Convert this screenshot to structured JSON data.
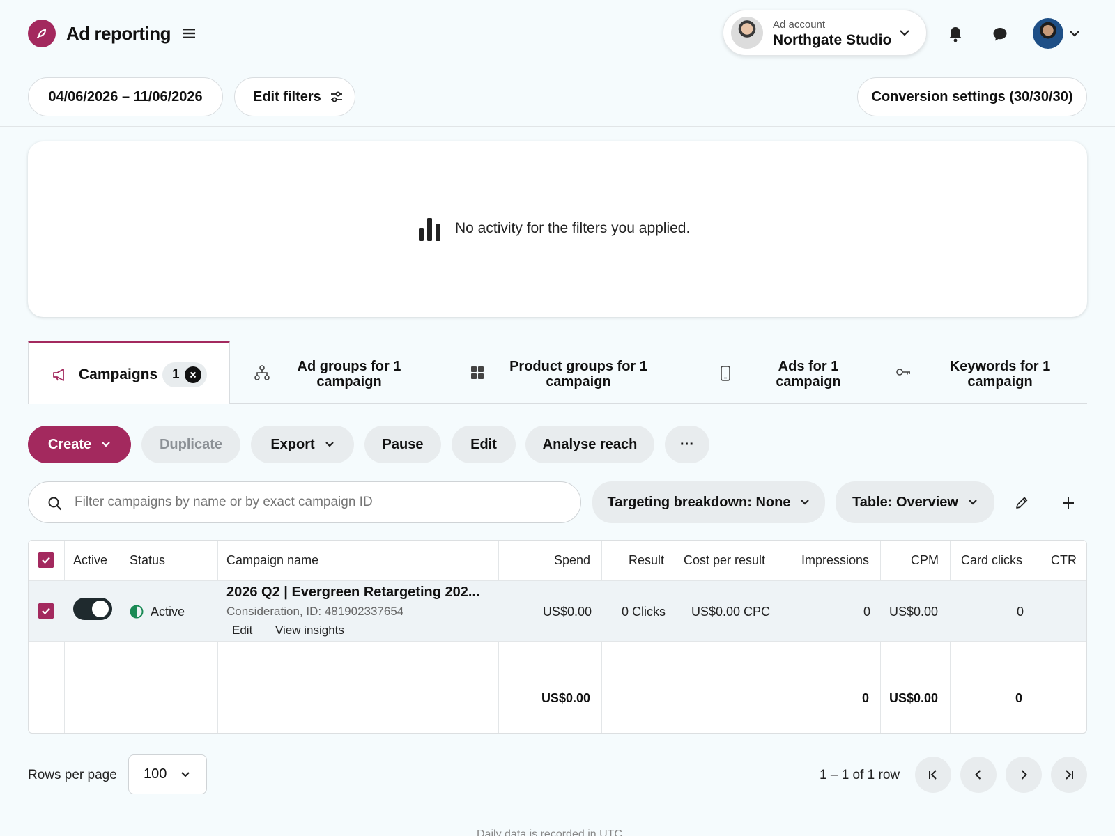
{
  "header": {
    "title": "Ad reporting",
    "account_label": "Ad account",
    "account_name": "Northgate Studio"
  },
  "toolbar": {
    "date_range": "04/06/2026 – 11/06/2026",
    "edit_filters": "Edit filters",
    "conversion_settings": "Conversion settings (30/30/30)"
  },
  "empty_state": {
    "message": "No activity for the filters you applied."
  },
  "tabs": [
    {
      "label": "Campaigns",
      "count": "1",
      "icon": "megaphone-icon"
    },
    {
      "label": "Ad groups for 1 campaign",
      "icon": "hierarchy-icon"
    },
    {
      "label": "Product groups for 1 campaign",
      "icon": "grid-icon"
    },
    {
      "label": "Ads for 1 campaign",
      "icon": "phone-icon"
    },
    {
      "label": "Keywords for 1 campaign",
      "icon": "key-icon"
    }
  ],
  "actions": {
    "create": "Create",
    "duplicate": "Duplicate",
    "export": "Export",
    "pause": "Pause",
    "edit": "Edit",
    "analyse_reach": "Analyse reach",
    "more": "···"
  },
  "filter": {
    "search_placeholder": "Filter campaigns by name or by exact campaign ID",
    "targeting_breakdown": "Targeting breakdown: None",
    "table_view": "Table: Overview"
  },
  "table": {
    "columns": [
      "Active",
      "Status",
      "Campaign name",
      "Spend",
      "Result",
      "Cost per result",
      "Impressions",
      "CPM",
      "Card clicks",
      "CTR"
    ],
    "rows": [
      {
        "active": true,
        "status": "Active",
        "campaign_name": "2026 Q2 | Evergreen Retargeting 202...",
        "campaign_meta": "Consideration, ID: 481902337654",
        "edit_link": "Edit",
        "insights_link": "View insights",
        "spend": "US$0.00",
        "result": "0 Clicks",
        "cost_per_result": "US$0.00 CPC",
        "impressions": "0",
        "cpm": "US$0.00",
        "card_clicks": "0",
        "ctr": ""
      }
    ],
    "totals": {
      "spend": "US$0.00",
      "impressions": "0",
      "cpm": "US$0.00",
      "card_clicks": "0"
    }
  },
  "pagination": {
    "rows_per_page_label": "Rows per page",
    "rows_per_page": "100",
    "range": "1 – 1 of 1 row"
  },
  "footer": {
    "note": "Daily data is recorded in UTC"
  },
  "colors": {
    "brand": "#a3295e",
    "status_active": "#1a8a55"
  }
}
